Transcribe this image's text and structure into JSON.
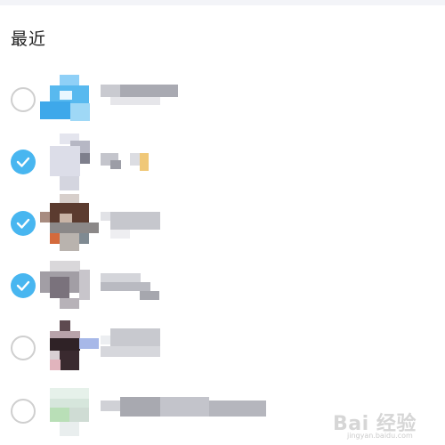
{
  "section": {
    "title": "最近"
  },
  "contacts": [
    {
      "selected": false
    },
    {
      "selected": true
    },
    {
      "selected": true
    },
    {
      "selected": true
    },
    {
      "selected": false
    },
    {
      "selected": false
    }
  ],
  "colors": {
    "accent": "#48b6f0",
    "radio_border": "#cfcfcf",
    "text": "#222222"
  },
  "watermark": {
    "main": "Bai 经验",
    "sub": "jingyan.baidu.com"
  }
}
